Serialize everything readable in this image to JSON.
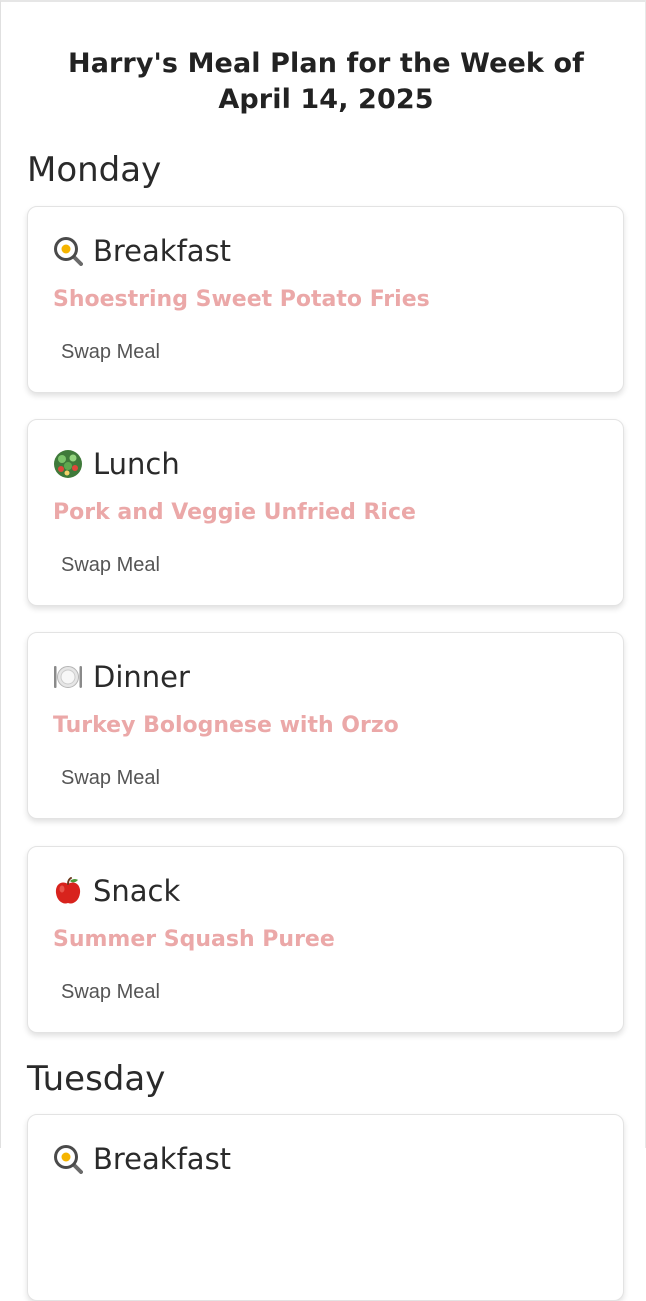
{
  "page": {
    "title": "Harry's Meal Plan for the Week of April 14, 2025"
  },
  "days": [
    {
      "name": "Monday",
      "meals": [
        {
          "label": "Breakfast",
          "icon": "frying-pan-egg-icon",
          "recipe": "Shoestring Sweet Potato Fries",
          "swap_label": "Swap Meal"
        },
        {
          "label": "Lunch",
          "icon": "salad-bowl-icon",
          "recipe": "Pork and Veggie Unfried Rice",
          "swap_label": "Swap Meal"
        },
        {
          "label": "Dinner",
          "icon": "plate-fork-knife-icon",
          "recipe": "Turkey Bolognese with Orzo",
          "swap_label": "Swap Meal"
        },
        {
          "label": "Snack",
          "icon": "red-apple-icon",
          "recipe": "Summer Squash Puree",
          "swap_label": "Swap Meal"
        }
      ]
    },
    {
      "name": "Tuesday",
      "meals": [
        {
          "label": "Breakfast",
          "icon": "frying-pan-egg-icon"
        }
      ]
    }
  ],
  "colors": {
    "recipe": "#eba8a8",
    "text": "#222222",
    "swap": "#555555"
  }
}
